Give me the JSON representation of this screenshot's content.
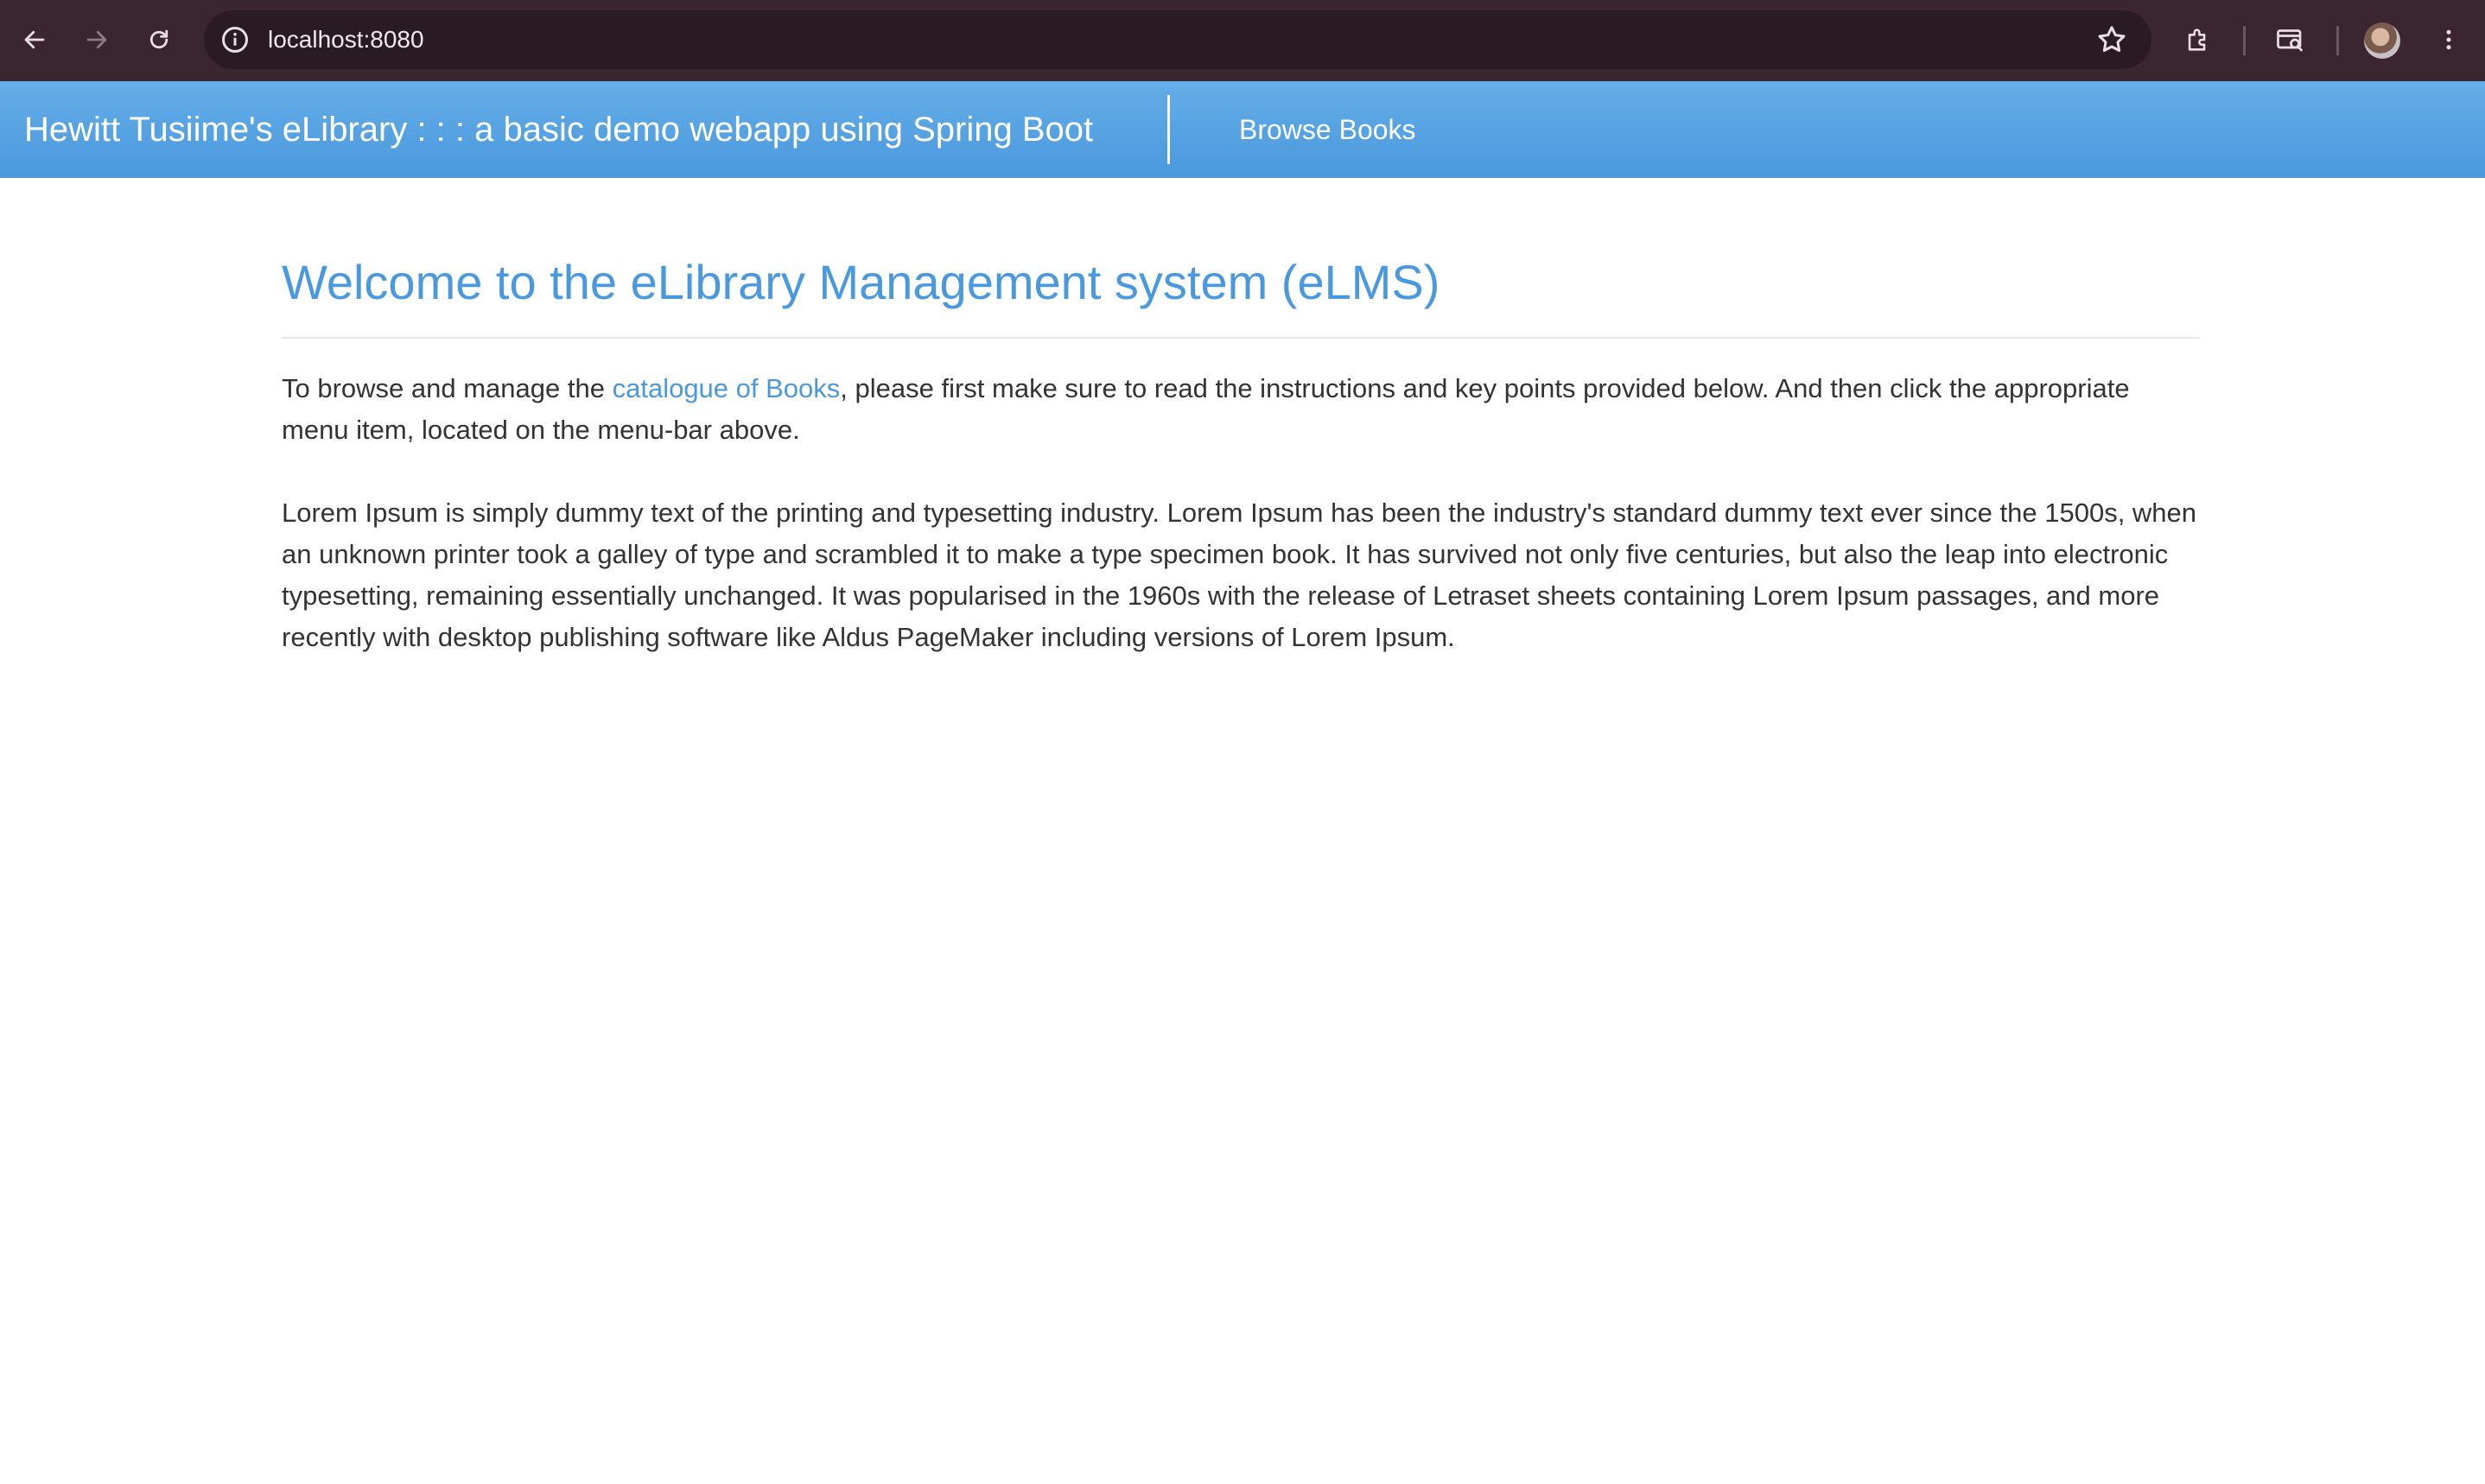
{
  "browser": {
    "url": "localhost:8080"
  },
  "header": {
    "brand": "Hewitt Tusiime's eLibrary : : : a basic demo webapp using Spring Boot",
    "nav_browse": "Browse Books"
  },
  "main": {
    "title": "Welcome to the eLibrary Management system (eLMS)",
    "intro_before": "To browse and manage the ",
    "intro_link": "catalogue of Books",
    "intro_after": ", please first make sure to read the instructions and key points provided below. And then click the appropriate menu item, located on the menu-bar above.",
    "lorem": "Lorem Ipsum is simply dummy text of the printing and typesetting industry. Lorem Ipsum has been the industry's standard dummy text ever since the 1500s, when an unknown printer took a galley of type and scrambled it to make a type specimen book. It has survived not only five centuries, but also the leap into electronic typesetting, remaining essentially unchanged. It was popularised in the 1960s with the release of Letraset sheets containing Lorem Ipsum passages, and more recently with desktop publishing software like Aldus PageMaker including versions of Lorem Ipsum."
  },
  "colors": {
    "accent": "#4a98dd",
    "chrome": "#3a2530"
  }
}
